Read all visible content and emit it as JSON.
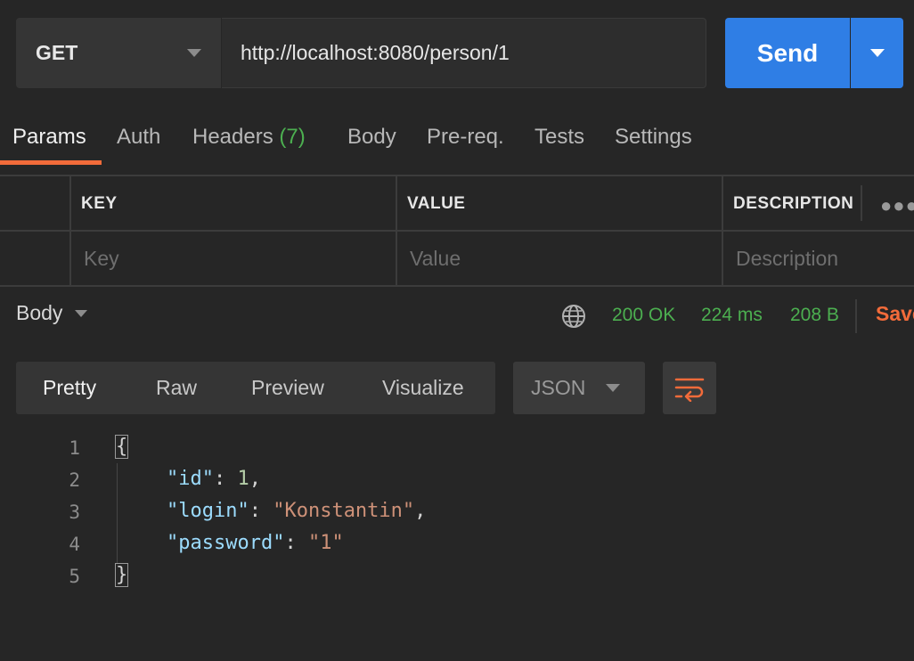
{
  "request": {
    "method": "GET",
    "url": "http://localhost:8080/person/1",
    "send_label": "Send"
  },
  "tabs": {
    "params": "Params",
    "auth": "Auth",
    "headers": "Headers",
    "headers_count": "(7)",
    "body": "Body",
    "prereq": "Pre-req.",
    "tests": "Tests",
    "settings": "Settings"
  },
  "params_table": {
    "headers": [
      "KEY",
      "VALUE",
      "DESCRIPTION"
    ],
    "placeholders": [
      "Key",
      "Value",
      "Description"
    ]
  },
  "response": {
    "body_label": "Body",
    "status": "200 OK",
    "time": "224 ms",
    "size": "208 B",
    "save_label": "Save"
  },
  "view": {
    "tabs": [
      "Pretty",
      "Raw",
      "Preview",
      "Visualize"
    ],
    "format": "JSON"
  },
  "code": {
    "line_numbers": [
      "1",
      "2",
      "3",
      "4",
      "5"
    ],
    "open_brace": "{",
    "close_brace": "}",
    "fields": [
      {
        "key": "\"id\"",
        "value": "1",
        "kind": "num",
        "comma": ","
      },
      {
        "key": "\"login\"",
        "value": "\"Konstantin\"",
        "kind": "str",
        "comma": ","
      },
      {
        "key": "\"password\"",
        "value": "\"1\"",
        "kind": "str",
        "comma": ""
      }
    ]
  },
  "colors": {
    "accent": "#f26b3a",
    "send": "#2f7ee5",
    "success": "#4caf50"
  }
}
